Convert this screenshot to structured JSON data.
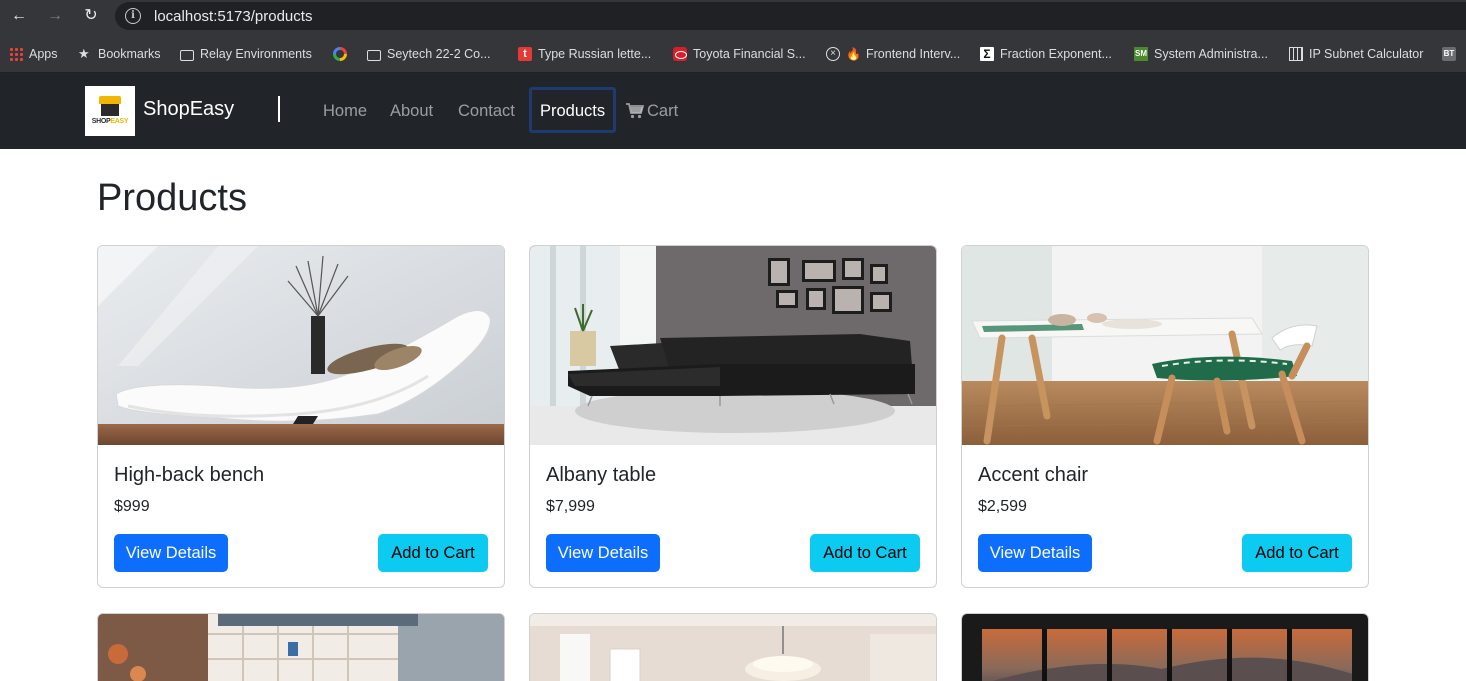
{
  "browser": {
    "url": "localhost:5173/products",
    "bookmarks": [
      {
        "label": "Apps",
        "icon": "apps-grid-icon"
      },
      {
        "label": "Bookmarks",
        "icon": "star-icon"
      },
      {
        "label": "Relay Environments",
        "icon": "folder-icon"
      },
      {
        "label": "",
        "icon": "google-icon"
      },
      {
        "label": "Seytech 22-2 Co...",
        "icon": "folder-icon"
      },
      {
        "label": "Type Russian lette...",
        "icon": "t-logo-icon"
      },
      {
        "label": "Toyota Financial S...",
        "icon": "toyota-logo-icon"
      },
      {
        "label": "Frontend Interv...",
        "icon": "x-circle-icon"
      },
      {
        "label": "Fraction Exponent...",
        "icon": "sigma-icon"
      },
      {
        "label": "System Administra...",
        "icon": "sm-logo-icon"
      },
      {
        "label": "IP Subnet Calculator",
        "icon": "calculator-icon"
      },
      {
        "label": "",
        "icon": "bt-logo-icon"
      }
    ]
  },
  "navbar": {
    "logo_text_1": "SHOP",
    "logo_text_2": "EASY",
    "brand": "ShopEasy",
    "links": [
      "Home",
      "About",
      "Contact",
      "Products",
      "Cart"
    ],
    "active": "Products"
  },
  "page": {
    "title": "Products",
    "products": [
      {
        "name": "High-back bench",
        "price": "$999",
        "details_label": "View Details",
        "cart_label": "Add to Cart"
      },
      {
        "name": "Albany table",
        "price": "$7,999",
        "details_label": "View Details",
        "cart_label": "Add to Cart"
      },
      {
        "name": "Accent chair",
        "price": "$2,599",
        "details_label": "View Details",
        "cart_label": "Add to Cart"
      }
    ]
  },
  "colors": {
    "navbar_bg": "#212529",
    "primary": "#0d6efd",
    "info": "#0dcaf0"
  }
}
